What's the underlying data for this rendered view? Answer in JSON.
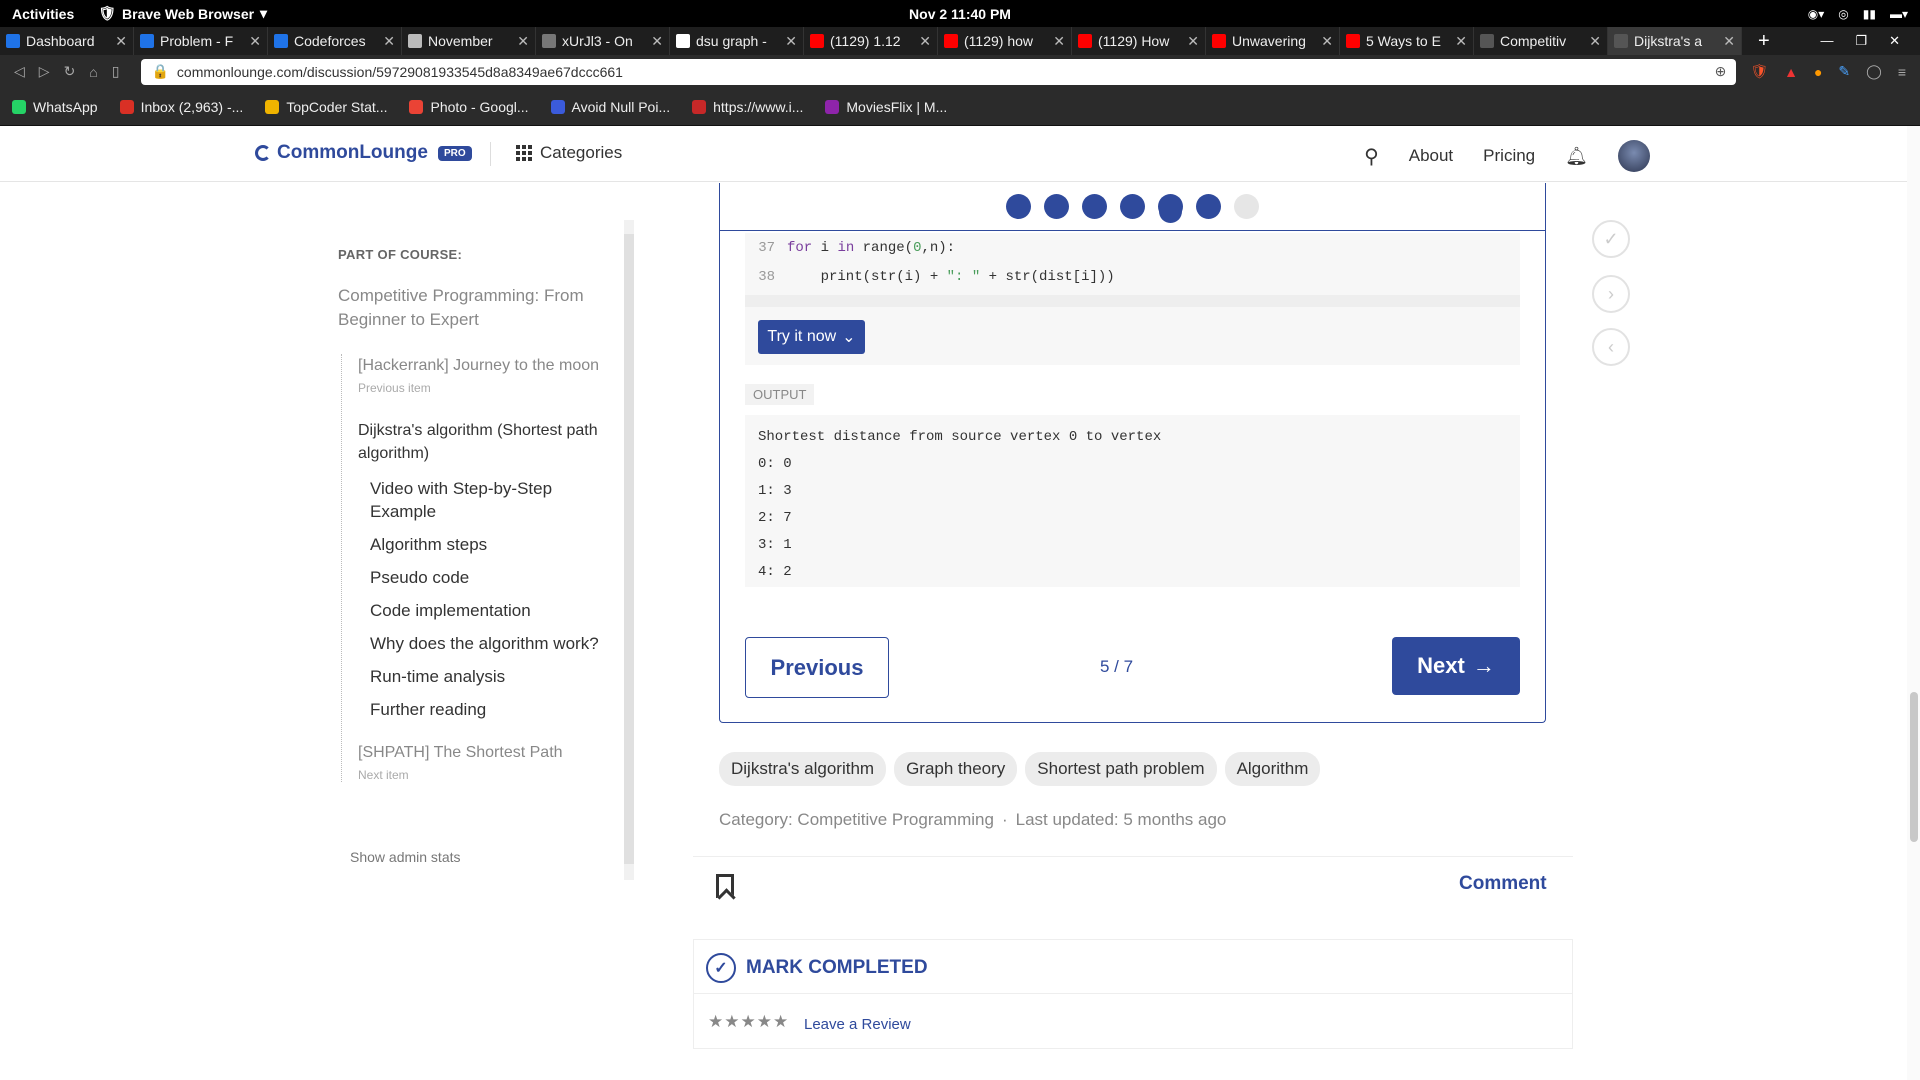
{
  "system": {
    "activities": "Activities",
    "browser_name": "Brave Web Browser",
    "clock": "Nov 2  11:40 PM"
  },
  "tabs": [
    {
      "title": "Dashboard",
      "color": "#1f73e8"
    },
    {
      "title": "Problem - F",
      "color": "#1f73e8"
    },
    {
      "title": "Codeforces",
      "color": "#1f73e8"
    },
    {
      "title": "November",
      "color": "#bbbbbb"
    },
    {
      "title": "xUrJl3 - On",
      "color": "#777777"
    },
    {
      "title": "dsu graph -",
      "color": "#ffffff"
    },
    {
      "title": "(1129) 1.12",
      "color": "#ff0000"
    },
    {
      "title": "(1129) how",
      "color": "#ff0000"
    },
    {
      "title": "(1129) How",
      "color": "#ff0000"
    },
    {
      "title": "Unwavering",
      "color": "#ff0000"
    },
    {
      "title": "5 Ways to E",
      "color": "#ff0000"
    },
    {
      "title": "Competitiv",
      "color": "#555555"
    },
    {
      "title": "Dijkstra's a",
      "color": "#555555"
    }
  ],
  "address": {
    "url": "commonlounge.com/discussion/59729081933545d8a8349ae67dccc661"
  },
  "bookmarks": [
    {
      "label": "WhatsApp",
      "color": "#25d366"
    },
    {
      "label": "Inbox (2,963) -...",
      "color": "#d93025"
    },
    {
      "label": "TopCoder Stat...",
      "color": "#f0b400"
    },
    {
      "label": "Photo - Googl...",
      "color": "#ea4335"
    },
    {
      "label": "Avoid Null Poi...",
      "color": "#3b5bdb"
    },
    {
      "label": "https://www.i...",
      "color": "#c62828"
    },
    {
      "label": "MoviesFlix | M...",
      "color": "#8e24aa"
    }
  ],
  "header": {
    "logo": "CommonLounge",
    "pro": "PRO",
    "categories": "Categories",
    "about": "About",
    "pricing": "Pricing"
  },
  "sidebar": {
    "part_of_course": "PART OF COURSE:",
    "course_title": "Competitive Programming: From Beginner to Expert",
    "prev_item": "[Hackerrank] Journey to the moon",
    "prev_label": "Previous item",
    "current_item": "Dijkstra's algorithm (Shortest path algorithm)",
    "steps": [
      "Video with Step-by-Step Example",
      "Algorithm steps",
      "Pseudo code",
      "Code implementation",
      "Why does the algorithm work?",
      "Run-time analysis",
      "Further reading"
    ],
    "next_item": "[SHPATH] The Shortest Path",
    "next_label": "Next item",
    "admin": "Show admin stats"
  },
  "code": {
    "lines": [
      {
        "num": "37",
        "text": "for i in range(0,n):"
      },
      {
        "num": "38",
        "text": "    print(str(i) + \": \" + str(dist[i]))"
      }
    ],
    "try_label": "Try it now"
  },
  "output": {
    "label": "OUTPUT",
    "lines": [
      "Shortest distance from source vertex 0 to vertex",
      "0: 0",
      "1: 3",
      "2: 7",
      "3: 1",
      "4: 2"
    ]
  },
  "nav": {
    "previous": "Previous",
    "page": "5 / 7",
    "next": "Next",
    "current_page": 5,
    "total_pages": 7
  },
  "tags": [
    "Dijkstra's algorithm",
    "Graph theory",
    "Shortest path problem",
    "Algorithm"
  ],
  "meta": {
    "category": "Category: Competitive Programming",
    "sep": "·",
    "updated": "Last updated: 5 months ago"
  },
  "actions": {
    "comment": "Comment",
    "mark_completed": "MARK COMPLETED",
    "stars": "★★★★★",
    "review": "Leave a Review"
  },
  "colors": {
    "brand": "#2f4a9c"
  }
}
